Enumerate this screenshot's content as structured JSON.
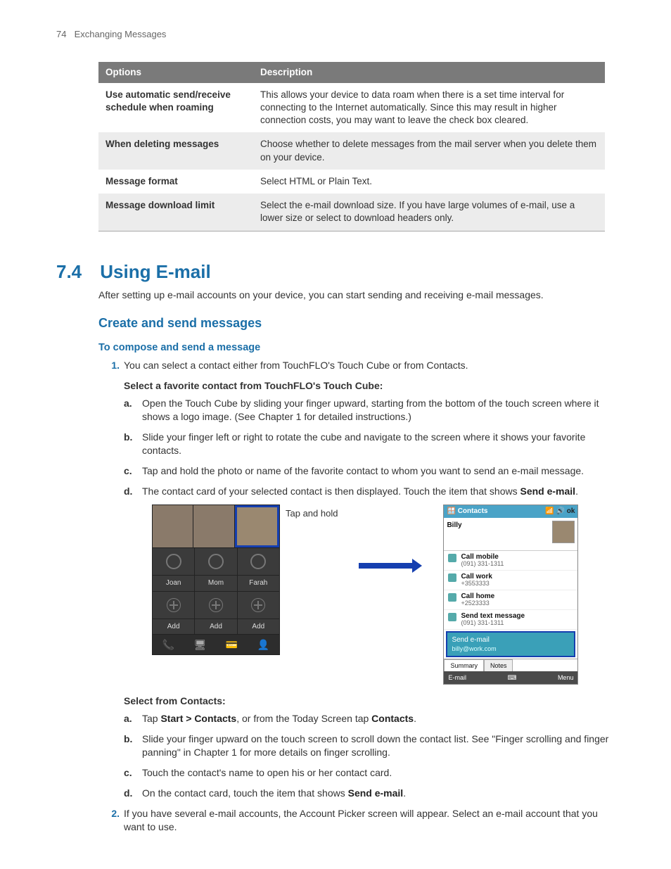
{
  "page_header": {
    "number": "74",
    "title": "Exchanging Messages"
  },
  "table": {
    "headers": {
      "options": "Options",
      "description": "Description"
    },
    "rows": [
      {
        "option": "Use automatic send/receive schedule when roaming",
        "desc": "This allows your device to data roam when there is a set time interval for connecting to the Internet automatically.  Since this may result in higher connection costs, you may want to leave the check box cleared."
      },
      {
        "option": "When deleting messages",
        "desc": "Choose whether to delete messages from the mail server when you delete them on your device."
      },
      {
        "option": "Message format",
        "desc": "Select HTML or Plain Text."
      },
      {
        "option": "Message download limit",
        "desc": "Select the e-mail download size. If you have large volumes of e-mail, use a lower size or select to download headers only."
      }
    ]
  },
  "section": {
    "number": "7.4",
    "title": "Using E-mail"
  },
  "intro": "After setting up e-mail accounts on your device, you can start sending and receiving e-mail messages.",
  "subheading": "Create and send messages",
  "task1_title": "To compose and send a message",
  "step1_text": "You can select a contact either from TouchFLO's Touch Cube or from Contacts.",
  "favorites_heading": "Select a favorite contact from TouchFLO's Touch Cube:",
  "fav_steps": {
    "a": "Open the Touch Cube by sliding your finger upward, starting from the bottom of the touch screen where it shows a logo image. (See Chapter 1 for detailed instructions.)",
    "b": "Slide your finger left or right to rotate the cube and navigate to the screen where it shows your favorite contacts.",
    "c": "Tap and hold the photo or name of the favorite contact to whom you want to send an e-mail message.",
    "d_pre": "The contact card of your selected contact is then displayed. Touch the item that shows ",
    "d_bold": "Send e-mail",
    "d_post": "."
  },
  "tap_and_hold": "Tap and hold",
  "cube": {
    "row_names": {
      "c1": "Joan",
      "c2": "Mom",
      "c3": "Farah"
    },
    "row_add": {
      "c1": "Add",
      "c2": "Add",
      "c3": "Add"
    }
  },
  "card": {
    "title": "Contacts",
    "ok": "ok",
    "name": "Billy",
    "call_mobile": "Call mobile",
    "call_mobile_num": "(091) 331-1311",
    "call_work": "Call work",
    "call_work_num": "+3553333",
    "call_home": "Call home",
    "call_home_num": "+2523333",
    "send_text": "Send text message",
    "send_text_num": "(091) 331-1311",
    "send_email": "Send e-mail",
    "send_email_addr": "billy@work.com",
    "tab_summary": "Summary",
    "tab_notes": "Notes",
    "foot_left": "E-mail",
    "foot_right": "Menu"
  },
  "contacts_heading": "Select from Contacts:",
  "contacts_steps": {
    "a_pre": "Tap ",
    "a_b1": "Start > Contacts",
    "a_mid": ", or from the Today Screen tap ",
    "a_b2": "Contacts",
    "a_post": ".",
    "b": "Slide your finger upward on the touch screen to scroll down the contact list. See \"Finger scrolling and finger panning\" in Chapter 1 for more details on finger scrolling.",
    "c": "Touch the contact's name to open his or her contact card.",
    "d_pre": "On the contact card, touch the item that shows ",
    "d_bold": "Send e-mail",
    "d_post": "."
  },
  "step2_text": "If you have several e-mail accounts, the Account Picker screen will appear. Select an e-mail account that you want to use."
}
